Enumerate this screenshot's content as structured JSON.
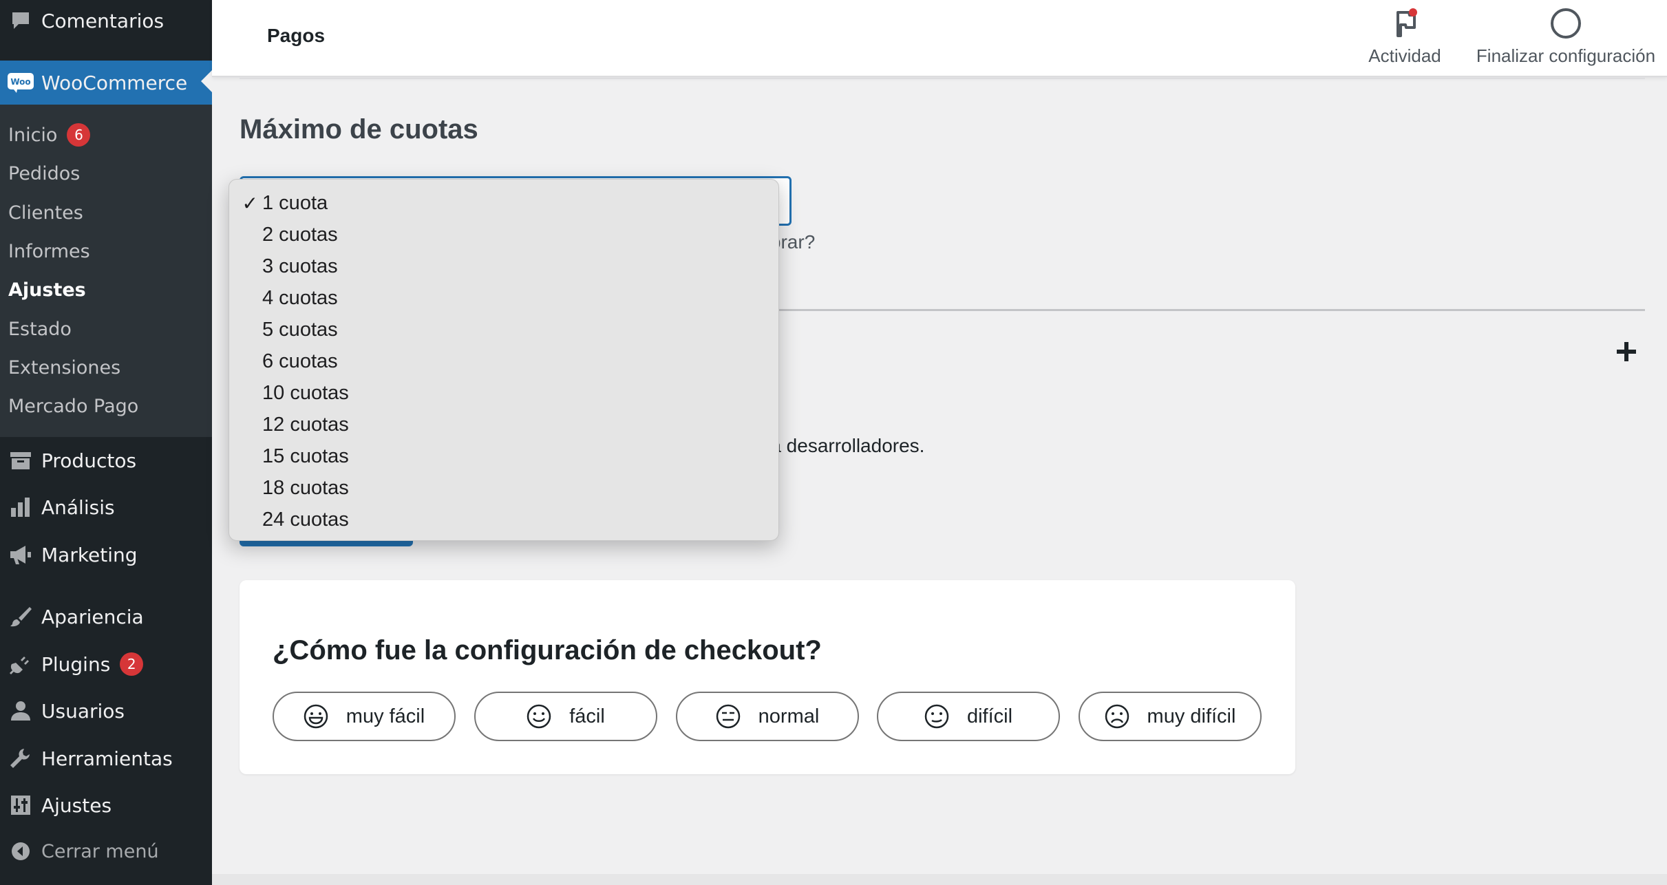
{
  "sidebar": {
    "top_item": {
      "label": "Comentarios",
      "icon": "comment-icon"
    },
    "woocommerce": {
      "label": "WooCommerce",
      "icon": "woo-logo-icon",
      "logo_text": "Woo"
    },
    "submenu": [
      {
        "label": "Inicio",
        "badge": "6"
      },
      {
        "label": "Pedidos"
      },
      {
        "label": "Clientes"
      },
      {
        "label": "Informes"
      },
      {
        "label": "Ajustes",
        "active": true
      },
      {
        "label": "Estado"
      },
      {
        "label": "Extensiones"
      },
      {
        "label": "Mercado Pago"
      }
    ],
    "items": [
      {
        "label": "Productos",
        "icon": "archive-icon"
      },
      {
        "label": "Análisis",
        "icon": "bar-chart-icon"
      },
      {
        "label": "Marketing",
        "icon": "megaphone-icon"
      },
      {
        "label": "Apariencia",
        "icon": "paintbrush-icon"
      },
      {
        "label": "Plugins",
        "icon": "plug-icon",
        "badge": "2"
      },
      {
        "label": "Usuarios",
        "icon": "user-icon"
      },
      {
        "label": "Herramientas",
        "icon": "wrench-icon"
      },
      {
        "label": "Ajustes",
        "icon": "sliders-icon"
      }
    ],
    "collapse": {
      "label": "Cerrar menú",
      "icon": "collapse-arrow-icon"
    }
  },
  "header": {
    "title": "Pagos",
    "activity_label": "Actividad",
    "finish_label": "Finalizar configuración"
  },
  "main": {
    "section_title": "Máximo de cuotas",
    "help_text_fragment": "omprar?",
    "dev_text_fragment": "ra desarrolladores."
  },
  "dropdown": {
    "selected": "1 cuota",
    "check_mark": "✓",
    "options": [
      "1 cuota",
      "2 cuotas",
      "3 cuotas",
      "4 cuotas",
      "5 cuotas",
      "6 cuotas",
      "10 cuotas",
      "12 cuotas",
      "15 cuotas",
      "18 cuotas",
      "24 cuotas"
    ]
  },
  "survey": {
    "title": "¿Cómo fue la configuración de checkout?",
    "options": [
      {
        "label": "muy fácil",
        "icon": "very-happy-face-icon"
      },
      {
        "label": "fácil",
        "icon": "happy-face-icon"
      },
      {
        "label": "normal",
        "icon": "neutral-face-icon"
      },
      {
        "label": "difícil",
        "icon": "sad-face-icon"
      },
      {
        "label": "muy difícil",
        "icon": "very-sad-face-icon"
      }
    ]
  },
  "colors": {
    "sidebar_bg": "#1d2327",
    "submenu_bg": "#2c3338",
    "accent": "#2271b1",
    "badge": "#d63638",
    "page_bg": "#f0f0f1"
  }
}
